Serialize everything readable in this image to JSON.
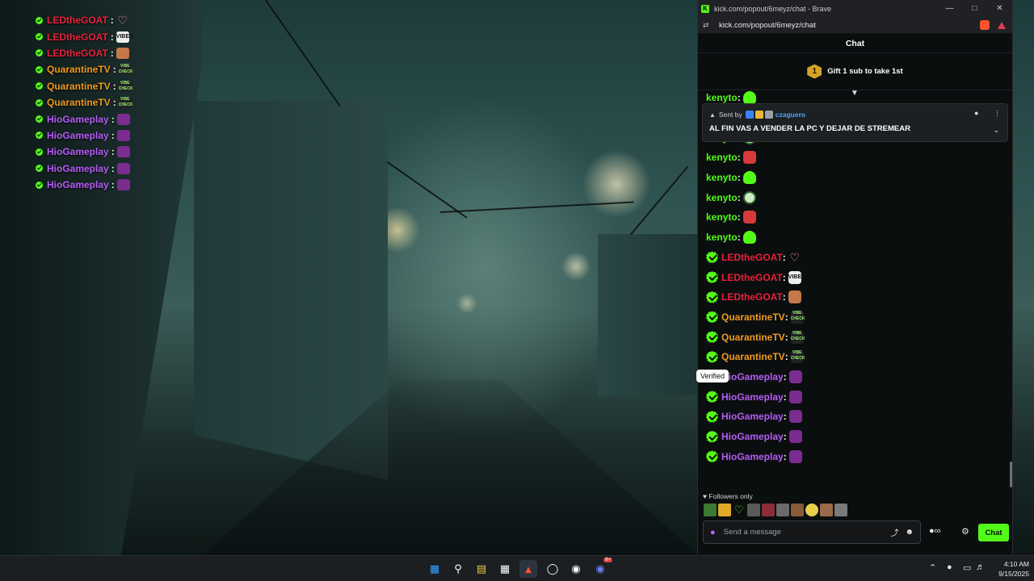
{
  "overlay_chat": [
    {
      "user": "LEDtheGOAT",
      "color": "#e8213a",
      "emote": "heart-emote"
    },
    {
      "user": "LEDtheGOAT",
      "color": "#e8213a",
      "emote": "vibes-emote"
    },
    {
      "user": "LEDtheGOAT",
      "color": "#e8213a",
      "emote": "dancing-emote"
    },
    {
      "user": "QuarantineTV",
      "color": "#f09a1e",
      "emote": "vibe-check-emote"
    },
    {
      "user": "QuarantineTV",
      "color": "#f09a1e",
      "emote": "vibe-check-emote"
    },
    {
      "user": "QuarantineTV",
      "color": "#f09a1e",
      "emote": "vibe-check-emote"
    },
    {
      "user": "HioGameplay",
      "color": "#b65bf5",
      "emote": "purple-emote"
    },
    {
      "user": "HioGameplay",
      "color": "#b65bf5",
      "emote": "purple-emote"
    },
    {
      "user": "HioGameplay",
      "color": "#b65bf5",
      "emote": "purple-emote"
    },
    {
      "user": "HioGameplay",
      "color": "#b65bf5",
      "emote": "purple-emote"
    },
    {
      "user": "HioGameplay",
      "color": "#b65bf5",
      "emote": "purple-emote"
    }
  ],
  "browser": {
    "title": "kick.com/popout/6meyz/chat - Brave",
    "url": "kick.com/popout/6meyz/chat"
  },
  "chat": {
    "header": "Chat",
    "gift_count": "1",
    "gift_text": "Gift 1 sub to take 1st",
    "pinned": {
      "sent_by_label": "Sent by",
      "user": "czaguero",
      "message": "AL FIN VAS A VENDER LA PC Y DEJAR DE STREMEAR"
    },
    "messages": [
      {
        "user": "kenyto",
        "color": "#53fc18",
        "verified": false,
        "emote": "ghost-emote"
      },
      {
        "user": "kenyto",
        "color": "#53fc18",
        "verified": false,
        "emote": "ghost-emote"
      },
      {
        "user": "kenyto",
        "color": "#53fc18",
        "verified": false,
        "emote": "skull-emote"
      },
      {
        "user": "kenyto",
        "color": "#53fc18",
        "verified": false,
        "emote": "angry-emote"
      },
      {
        "user": "kenyto",
        "color": "#53fc18",
        "verified": false,
        "emote": "ghost-emote"
      },
      {
        "user": "kenyto",
        "color": "#53fc18",
        "verified": false,
        "emote": "skull-emote"
      },
      {
        "user": "kenyto",
        "color": "#53fc18",
        "verified": false,
        "emote": "angry-emote"
      },
      {
        "user": "kenyto",
        "color": "#53fc18",
        "verified": false,
        "emote": "ghost-emote"
      },
      {
        "user": "LEDtheGOAT",
        "color": "#e8213a",
        "verified": true,
        "emote": "heart-emote"
      },
      {
        "user": "LEDtheGOAT",
        "color": "#e8213a",
        "verified": true,
        "emote": "vibes-emote"
      },
      {
        "user": "LEDtheGOAT",
        "color": "#e8213a",
        "verified": true,
        "emote": "dancing-emote"
      },
      {
        "user": "QuarantineTV",
        "color": "#f09a1e",
        "verified": true,
        "emote": "vibe-check-emote"
      },
      {
        "user": "QuarantineTV",
        "color": "#f09a1e",
        "verified": true,
        "emote": "vibe-check-emote"
      },
      {
        "user": "QuarantineTV",
        "color": "#f09a1e",
        "verified": true,
        "emote": "vibe-check-emote"
      },
      {
        "user": "HioGameplay",
        "color": "#b65bf5",
        "verified": true,
        "emote": "purple-emote"
      },
      {
        "user": "HioGameplay",
        "color": "#b65bf5",
        "verified": true,
        "emote": "purple-emote"
      },
      {
        "user": "HioGameplay",
        "color": "#b65bf5",
        "verified": true,
        "emote": "purple-emote"
      },
      {
        "user": "HioGameplay",
        "color": "#b65bf5",
        "verified": true,
        "emote": "purple-emote"
      },
      {
        "user": "HioGameplay",
        "color": "#b65bf5",
        "verified": true,
        "emote": "purple-emote"
      }
    ],
    "tooltip": "Verified",
    "followers_only": "Followers only",
    "input_placeholder": "Send a message",
    "send_label": "Chat"
  },
  "emote_bar": [
    "frog-emote",
    "crown-emote",
    "heart-outline-emote",
    "face-emote-1",
    "face-emote-2",
    "face-emote-3",
    "face-emote-4",
    "yellow-face-emote",
    "face-emote-5",
    "face-emote-6"
  ],
  "emote_labels": {
    "vibes": "VIBES",
    "vibe_check": "VIBE CHECK"
  },
  "taskbar": {
    "time": "4:10 AM",
    "date": "9/15/2025",
    "apps": [
      "windows-start-icon",
      "search-icon",
      "file-explorer-icon",
      "store-icon",
      "brave-browser-icon",
      "obs-icon",
      "steam-icon",
      "discord-icon"
    ],
    "discord_badge": "9+"
  },
  "colors": {
    "accent": "#53fc18",
    "led": "#e8213a",
    "quarantine": "#f09a1e",
    "hio": "#b65bf5",
    "pinned_user": "#4aa8ff"
  }
}
